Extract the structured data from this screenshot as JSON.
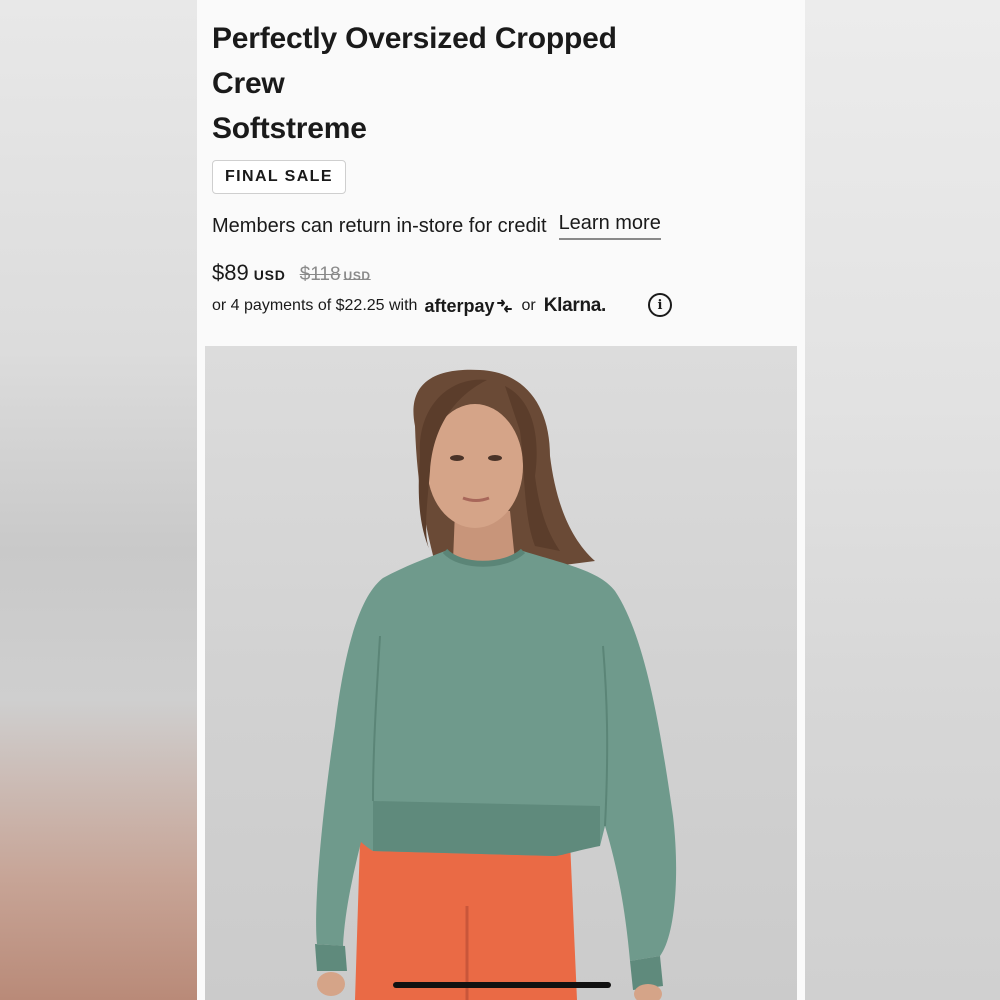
{
  "product": {
    "title_lines": [
      "Perfectly Oversized Cropped",
      "Crew",
      "Softstreme"
    ],
    "badge": "FINAL SALE",
    "returns_text": "Members can return in-store for credit",
    "learn_more": "Learn more",
    "price": "$89",
    "currency": "USD",
    "original_price": "$118",
    "original_currency": "USD",
    "payments_text": "or 4 payments of $22.25 with",
    "afterpay": "afterpay",
    "or": "or",
    "klarna": "Klarna.",
    "info_icon": "info-icon"
  },
  "colors": {
    "sweater": "#6f9a8c",
    "leggings": "#ea6a45",
    "background": "#fafafa",
    "photo_bg": "#d2d2d2"
  }
}
